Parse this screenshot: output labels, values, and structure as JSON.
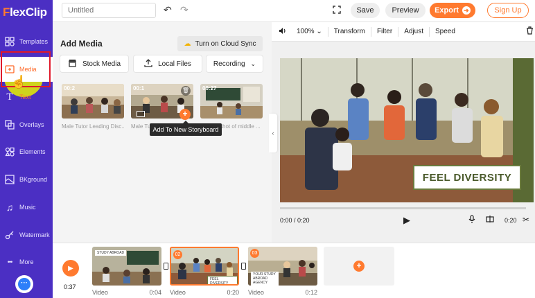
{
  "app": {
    "logo_text": "lexClip",
    "logo_initial": "F"
  },
  "sidebar": {
    "items": [
      {
        "label": "Templates",
        "icon": "templates-icon",
        "glyph": "⚙"
      },
      {
        "label": "Media",
        "icon": "media-icon",
        "glyph": "▣"
      },
      {
        "label": "Text",
        "icon": "text-icon",
        "glyph": "T"
      },
      {
        "label": "Overlays",
        "icon": "overlays-icon",
        "glyph": "❐"
      },
      {
        "label": "Elements",
        "icon": "elements-icon",
        "glyph": "✲"
      },
      {
        "label": "BKground",
        "icon": "background-icon",
        "glyph": "▨"
      },
      {
        "label": "Music",
        "icon": "music-icon",
        "glyph": "♫"
      },
      {
        "label": "Watermark",
        "icon": "watermark-icon",
        "glyph": "⌘"
      },
      {
        "label": "More",
        "icon": "more-icon",
        "glyph": "•••"
      }
    ],
    "active": "Media"
  },
  "topbar": {
    "title_placeholder": "Untitled",
    "save": "Save",
    "preview": "Preview",
    "export": "Export",
    "signup": "Sign Up"
  },
  "media_panel": {
    "title": "Add Media",
    "cloud_sync": "Turn on Cloud Sync",
    "sources": [
      "Stock Media",
      "Local Files",
      "Recording"
    ],
    "thumbs": [
      {
        "duration": "00:2",
        "caption": "Male Tutor Leading Disc..."
      },
      {
        "duration": "00:1",
        "caption": "Male Tu"
      },
      {
        "duration": "00:27",
        "caption": "shot of middle ..."
      }
    ],
    "tooltip": "Add To New Storyboard"
  },
  "preview": {
    "zoom": "100%",
    "tools": [
      "Transform",
      "Filter",
      "Adjust",
      "Speed"
    ],
    "overlay_text": "FEEL DIVERSITY",
    "time_current": "0:00 / 0:20",
    "time_end": "0:20"
  },
  "timeline": {
    "total": "0:37",
    "clips": [
      {
        "label": "Video",
        "duration": "0:04",
        "tag": "STUDY ABROAD",
        "num": ""
      },
      {
        "label": "Video",
        "duration": "0:20",
        "tag": "FEEL DIVERSITY",
        "num": "02"
      },
      {
        "label": "Video",
        "duration": "0:12",
        "tag": "YOUR STUDY ABROAD AGENCY",
        "num": "03"
      }
    ]
  },
  "colors": {
    "brand": "#4b2fc3",
    "accent": "#ff7a2f",
    "highlight": "#e6f000"
  }
}
